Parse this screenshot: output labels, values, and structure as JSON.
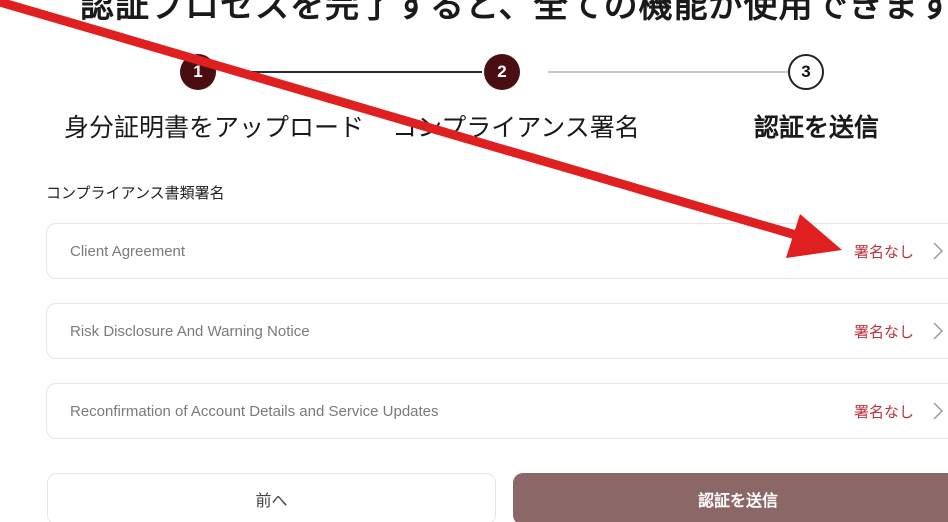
{
  "header": {
    "title": "認証プロセスを完了すると、全ての機能が使用できます"
  },
  "stepper": {
    "steps": [
      {
        "number": "1",
        "label": "身分証明書をアップロード"
      },
      {
        "number": "2",
        "label": "コンプライアンス署名"
      },
      {
        "number": "3",
        "label": "認証を送信"
      }
    ]
  },
  "section": {
    "title": "コンプライアンス書類署名"
  },
  "documents": [
    {
      "name": "Client Agreement",
      "status": "署名なし"
    },
    {
      "name": "Risk Disclosure And Warning Notice",
      "status": "署名なし"
    },
    {
      "name": "Reconfirmation of Account Details and Service Updates",
      "status": "署名なし"
    }
  ],
  "buttons": {
    "prev_label": "前へ",
    "submit_label": "認証を送信"
  },
  "colors": {
    "step_active": "#4a0d12",
    "status_text": "#c0303c",
    "submit_bg": "#8b6767",
    "annotation_arrow": "#e02020"
  },
  "icons": {
    "row_chevron": "chevron-right-icon"
  }
}
